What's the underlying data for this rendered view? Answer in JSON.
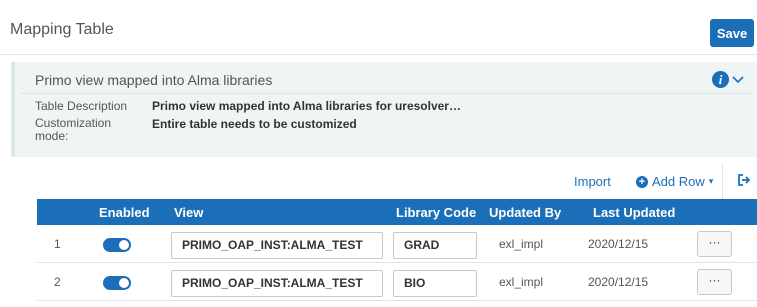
{
  "header": {
    "title": "Mapping Table",
    "save_label": "Save"
  },
  "info": {
    "title": "Primo view mapped into Alma libraries",
    "description_label": "Table Description",
    "description_value": "Primo view mapped into Alma libraries for uresolver…",
    "customization_label": "Customization mode:",
    "customization_value": "Entire table needs to be customized",
    "info_icon": "i"
  },
  "toolbar": {
    "import_label": "Import",
    "add_row_label": "Add Row",
    "add_row_icon": "+",
    "caret": "▾"
  },
  "table": {
    "columns": [
      "Enabled",
      "View",
      "Library Code",
      "Updated By",
      "Last Updated"
    ],
    "rows": [
      {
        "num": "1",
        "enabled": true,
        "view": "PRIMO_OAP_INST:ALMA_TEST",
        "library_code": "GRAD",
        "updated_by": "exl_impl",
        "last_updated": "2020/12/15",
        "actions": "···"
      },
      {
        "num": "2",
        "enabled": true,
        "view": "PRIMO_OAP_INST:ALMA_TEST",
        "library_code": "BIO",
        "updated_by": "exl_impl",
        "last_updated": "2020/12/15",
        "actions": "···"
      }
    ]
  },
  "colors": {
    "accent": "#1b6fb8",
    "panel_bg": "#eff4f5"
  }
}
